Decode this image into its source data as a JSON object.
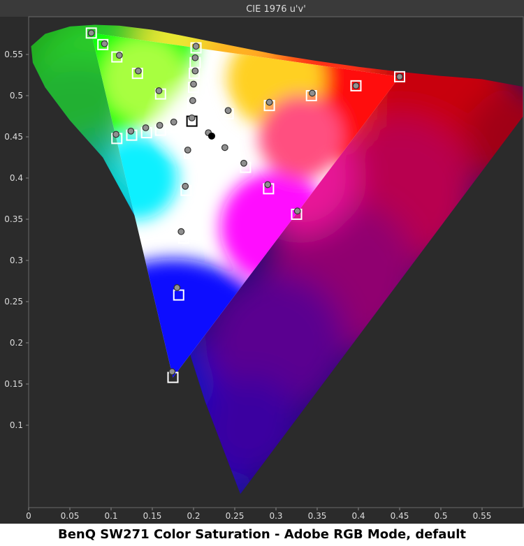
{
  "caption": "BenQ SW271 Color Saturation - Adobe RGB Mode, default",
  "chart_data": {
    "type": "scatter",
    "title": "CIE 1976 u'v'",
    "xlabel": "",
    "ylabel": "",
    "xlim": [
      0,
      0.6
    ],
    "ylim": [
      0,
      0.59
    ],
    "x_ticks": [
      "0",
      "0.05",
      "0.1",
      "0.15",
      "0.2",
      "0.25",
      "0.3",
      "0.35",
      "0.4",
      "0.45",
      "0.5",
      "0.55"
    ],
    "y_ticks": [
      "0.1",
      "0.15",
      "0.2",
      "0.25",
      "0.3",
      "0.35",
      "0.4",
      "0.45",
      "0.5",
      "0.55"
    ],
    "grid": false,
    "colors": {
      "background": "#2b2b2b",
      "frame": "#6a6a6a",
      "title_bar": "#3a3a3a",
      "text": "#dcdcdc"
    },
    "white_point": {
      "u": 0.198,
      "v": 0.469
    },
    "gamut_triangle": [
      [
        0.45,
        0.523
      ],
      [
        0.076,
        0.576
      ],
      [
        0.175,
        0.158
      ]
    ],
    "series": [
      {
        "marker": "square",
        "points": [
          [
            0.45,
            0.523
          ],
          [
            0.397,
            0.512
          ],
          [
            0.343,
            0.5
          ],
          [
            0.292,
            0.488
          ],
          [
            0.242,
            0.478
          ],
          [
            0.076,
            0.576
          ],
          [
            0.09,
            0.562
          ],
          [
            0.107,
            0.547
          ],
          [
            0.132,
            0.527
          ],
          [
            0.16,
            0.502
          ],
          [
            0.175,
            0.158
          ],
          [
            0.182,
            0.258
          ],
          [
            0.188,
            0.327
          ],
          [
            0.191,
            0.385
          ],
          [
            0.195,
            0.43
          ],
          [
            0.203,
            0.558
          ],
          [
            0.202,
            0.54
          ],
          [
            0.201,
            0.527
          ],
          [
            0.2,
            0.51
          ],
          [
            0.199,
            0.491
          ],
          [
            0.107,
            0.448
          ],
          [
            0.125,
            0.452
          ],
          [
            0.143,
            0.455
          ],
          [
            0.16,
            0.458
          ],
          [
            0.179,
            0.462
          ],
          [
            0.325,
            0.356
          ],
          [
            0.291,
            0.387
          ],
          [
            0.263,
            0.413
          ],
          [
            0.239,
            0.432
          ],
          [
            0.22,
            0.45
          ],
          [
            0.198,
            0.469
          ]
        ]
      },
      {
        "marker": "circle",
        "points": [
          [
            0.45,
            0.523
          ],
          [
            0.397,
            0.512
          ],
          [
            0.344,
            0.503
          ],
          [
            0.292,
            0.492
          ],
          [
            0.242,
            0.482
          ],
          [
            0.076,
            0.576
          ],
          [
            0.092,
            0.563
          ],
          [
            0.11,
            0.549
          ],
          [
            0.133,
            0.53
          ],
          [
            0.158,
            0.506
          ],
          [
            0.174,
            0.165
          ],
          [
            0.18,
            0.267
          ],
          [
            0.185,
            0.335
          ],
          [
            0.19,
            0.39
          ],
          [
            0.193,
            0.434
          ],
          [
            0.203,
            0.56
          ],
          [
            0.202,
            0.546
          ],
          [
            0.202,
            0.53
          ],
          [
            0.2,
            0.514
          ],
          [
            0.199,
            0.494
          ],
          [
            0.106,
            0.453
          ],
          [
            0.124,
            0.457
          ],
          [
            0.142,
            0.461
          ],
          [
            0.159,
            0.464
          ],
          [
            0.176,
            0.468
          ],
          [
            0.326,
            0.36
          ],
          [
            0.29,
            0.392
          ],
          [
            0.261,
            0.418
          ],
          [
            0.238,
            0.437
          ],
          [
            0.218,
            0.455
          ],
          [
            0.198,
            0.473
          ]
        ]
      }
    ]
  }
}
